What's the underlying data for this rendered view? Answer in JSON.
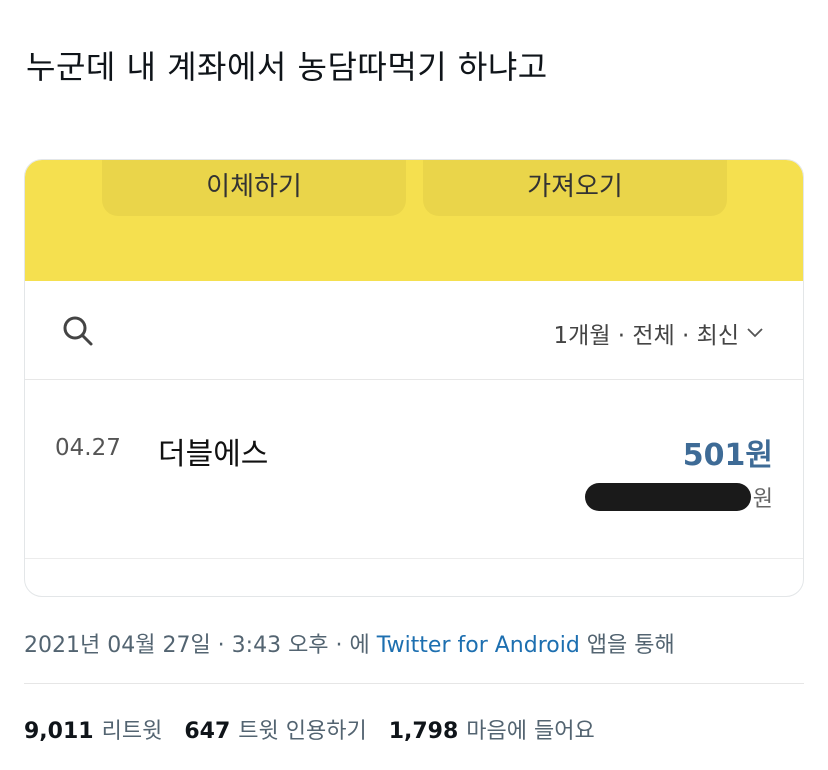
{
  "tweet": {
    "text": "누군데 내 계좌에서 농담따먹기 하냐고"
  },
  "card": {
    "header_buttons": [
      "이체하기",
      "가져오기"
    ],
    "filter": "1개월 · 전체 · 최신",
    "transaction": {
      "date": "04.27",
      "name": "더블에스",
      "amount": "501원",
      "balance_unit": "원"
    }
  },
  "meta": {
    "date": "2021년 04월 27일",
    "separator1": " · ",
    "time": "3:43 오후",
    "separator2": " · 에 ",
    "source": "Twitter for Android",
    "suffix": " 앱을 통해"
  },
  "stats": [
    {
      "count": "9,011",
      "label": "리트윗"
    },
    {
      "count": "647",
      "label": "트윗 인용하기"
    },
    {
      "count": "1,798",
      "label": "마음에 들어요"
    }
  ],
  "colors": {
    "header_yellow": "#f5e04f",
    "amount_blue": "#3e6b96",
    "link_blue": "#1d6fb0"
  }
}
